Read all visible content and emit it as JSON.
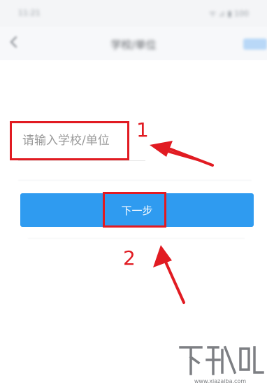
{
  "status_bar": {
    "time": "11:21",
    "icons_text": "ᯤ ⊿ ▮ 100"
  },
  "nav": {
    "back_icon": "back-arrow-icon",
    "title": "学校/单位",
    "action_color": "#b9d8f7"
  },
  "form": {
    "school_placeholder": "请输入学校/单位",
    "school_value": ""
  },
  "next_button": {
    "label": "下一步",
    "color": "#2f9bf0"
  },
  "annotations": {
    "marker_1": "1",
    "marker_2": "2",
    "color": "#e11b22"
  },
  "watermark": {
    "logo_text": "下载吧",
    "url": "www.xiazaiba.com"
  }
}
